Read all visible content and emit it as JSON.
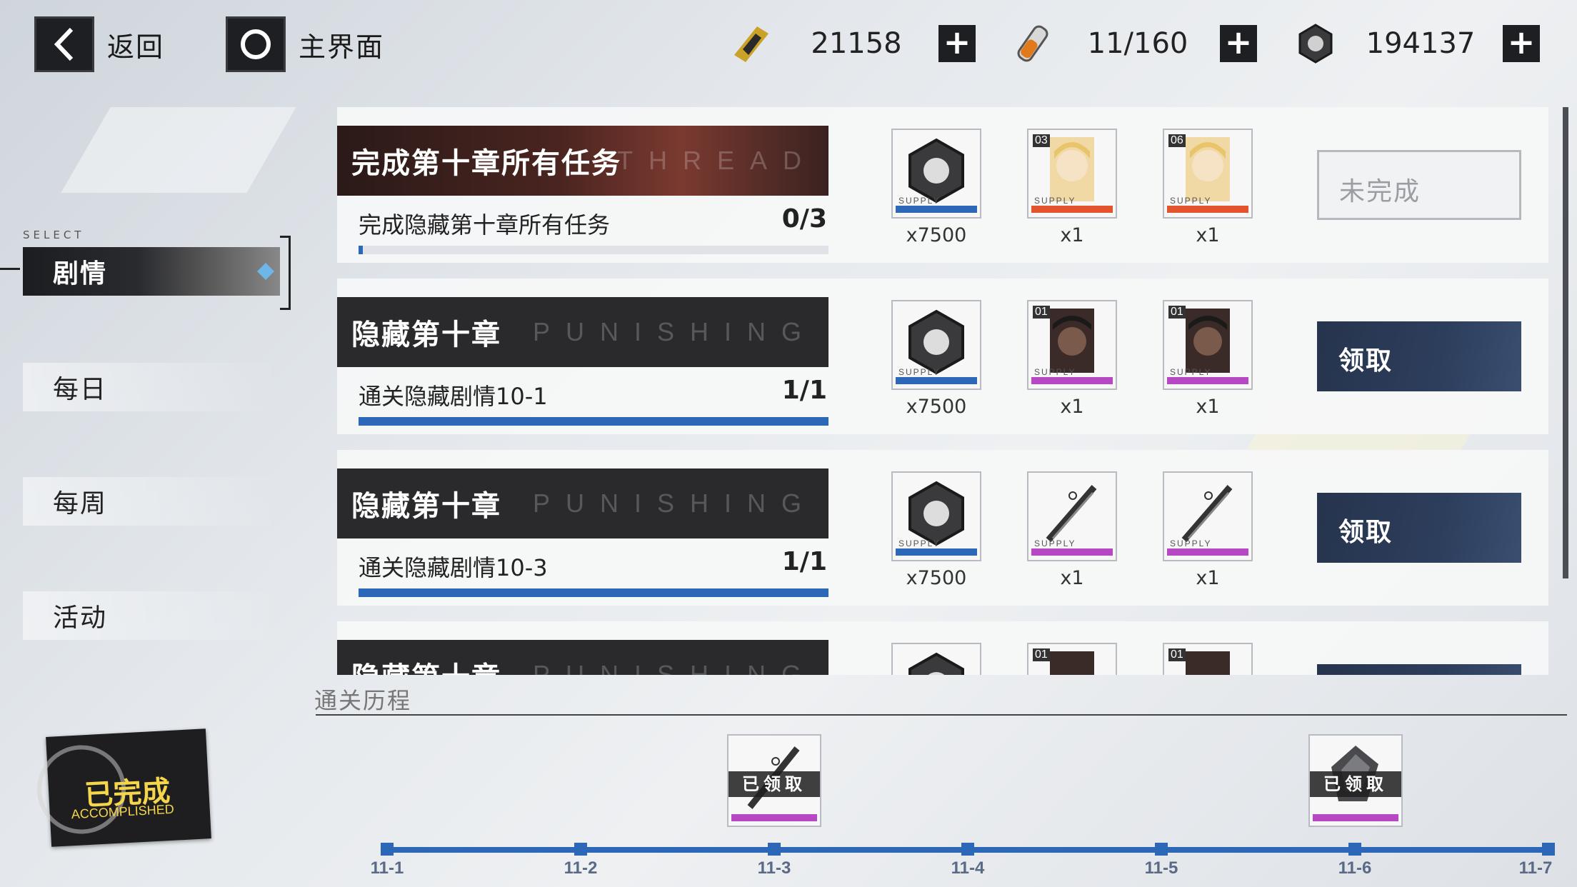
{
  "topbar": {
    "back_label": "返回",
    "home_label": "主界面",
    "resources": [
      {
        "icon": "gold-ticket-icon",
        "value": "21158"
      },
      {
        "icon": "stamina-tube-icon",
        "value": "11/160"
      },
      {
        "icon": "hex-nut-icon",
        "value": "194137"
      }
    ]
  },
  "nav": {
    "select_label": "SELECT",
    "items": [
      {
        "label": "剧情",
        "active": true
      },
      {
        "label": "每日",
        "active": false
      },
      {
        "label": "每周",
        "active": false
      },
      {
        "label": "活动",
        "active": false
      }
    ]
  },
  "tasks": [
    {
      "title": "完成第十章所有任务",
      "deco": "THREAD",
      "desc": "完成隐藏第十章所有任务",
      "progress": "0/3",
      "progress_fraction": 0.0,
      "rewards": [
        {
          "icon": "hex-nut-icon",
          "qty": "x7500",
          "num": ""
        },
        {
          "icon": "character-card-icon",
          "qty": "x1",
          "num": "03"
        },
        {
          "icon": "character-card-icon",
          "qty": "x1",
          "num": "06"
        }
      ],
      "button": "未完成"
    },
    {
      "title": "隐藏第十章",
      "deco": "PUNISHING",
      "desc": "通关隐藏剧情10-1",
      "progress": "1/1",
      "progress_fraction": 1.0,
      "rewards": [
        {
          "icon": "hex-nut-icon",
          "qty": "x7500",
          "num": ""
        },
        {
          "icon": "character-card-icon",
          "qty": "x1",
          "num": "01"
        },
        {
          "icon": "character-card-icon",
          "qty": "x1",
          "num": "01"
        }
      ],
      "button": "领取"
    },
    {
      "title": "隐藏第十章",
      "deco": "PUNISHING",
      "desc": "通关隐藏剧情10-3",
      "progress": "1/1",
      "progress_fraction": 1.0,
      "rewards": [
        {
          "icon": "hex-nut-icon",
          "qty": "x7500",
          "num": ""
        },
        {
          "icon": "weapon-part-icon",
          "qty": "x1",
          "num": ""
        },
        {
          "icon": "weapon-part-icon",
          "qty": "x1",
          "num": ""
        }
      ],
      "button": "领取"
    },
    {
      "title": "隐藏第十章",
      "deco": "PUNISHING",
      "desc": "",
      "progress": "",
      "progress_fraction": 0.0,
      "rewards": [
        {
          "icon": "hex-nut-icon",
          "qty": "",
          "num": ""
        },
        {
          "icon": "character-card-icon",
          "qty": "",
          "num": "01"
        },
        {
          "icon": "character-card-icon",
          "qty": "",
          "num": "01"
        }
      ],
      "button": ""
    }
  ],
  "history": {
    "title": "通关历程",
    "badge_cn": "已完成",
    "badge_en": "ACCOMPLISHED",
    "claimed_label": "已领取",
    "nodes": [
      "11-1",
      "11-2",
      "11-3",
      "11-4",
      "11-5",
      "11-6",
      "11-7"
    ],
    "milestones": [
      {
        "node": "11-3",
        "icon": "weapon-part-icon",
        "claimed": true
      },
      {
        "node": "11-6",
        "icon": "mech-part-icon",
        "claimed": true
      }
    ]
  },
  "colors": {
    "accent_blue": "#2d67b8",
    "claim_button": "#2d3e5c",
    "dark_ui": "#1e1f22",
    "badge_yellow": "#f5d64a"
  }
}
